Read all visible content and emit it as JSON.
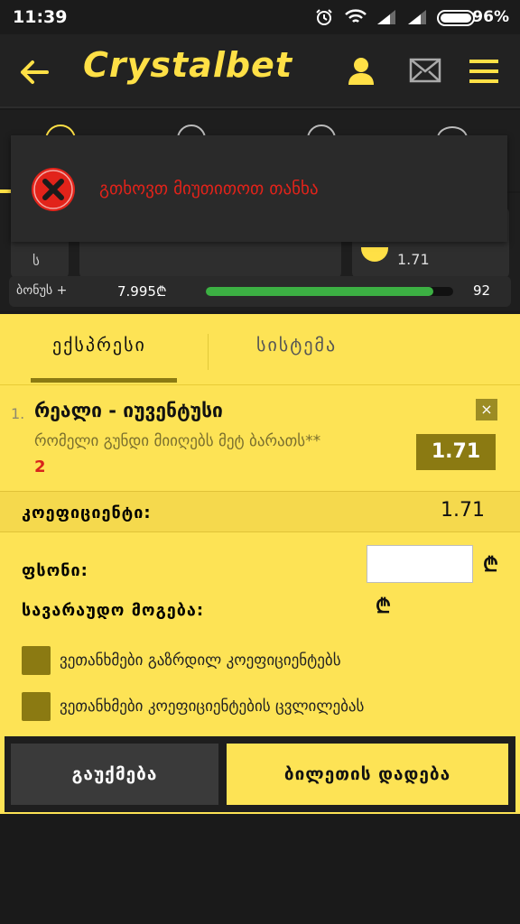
{
  "status_bar": {
    "time": "11:39",
    "battery": "96%"
  },
  "header": {
    "logo_part1": "Crystal",
    "logo_part2": "bet"
  },
  "toast": {
    "message": "გთხოვთ მიუთითოთ თანხა"
  },
  "background": {
    "odd_partial": "1.71",
    "left_partial": "ს"
  },
  "bonus": {
    "label": "ბონუს +",
    "amount": "7.995₾",
    "progress_fraction": 0.92,
    "count": "92"
  },
  "tabs": [
    {
      "label": "ექსპრესი",
      "active": true
    },
    {
      "label": "სისტემა",
      "active": false
    }
  ],
  "selection": {
    "index": "1.",
    "title": "რეალი - იუვენტუსი",
    "market": "რომელი გუნდი მიიღებს მეტ ბარათს**",
    "pick": "2",
    "close": "×",
    "odd": "1.71"
  },
  "coefficient": {
    "label": "კოეფიციენტი:",
    "value": "1.71"
  },
  "stake": {
    "label": "ფსონი:",
    "value": "",
    "currency": "₾"
  },
  "potential_win": {
    "label": "სავარაუდო მოგება:",
    "currency": "₾"
  },
  "options": [
    {
      "label": "ვეთანხმები გაზრდილ კოეფიციენტებს"
    },
    {
      "label": "ვეთანხმები კოეფიციენტების ცვლილებას"
    }
  ],
  "buttons": {
    "cancel": "გაუქმება",
    "place": "ბილეთის დადება"
  },
  "colors": {
    "accent": "#fde355",
    "dark_accent": "#8b7a12",
    "error": "#e2231a",
    "progress": "#3cb043"
  }
}
